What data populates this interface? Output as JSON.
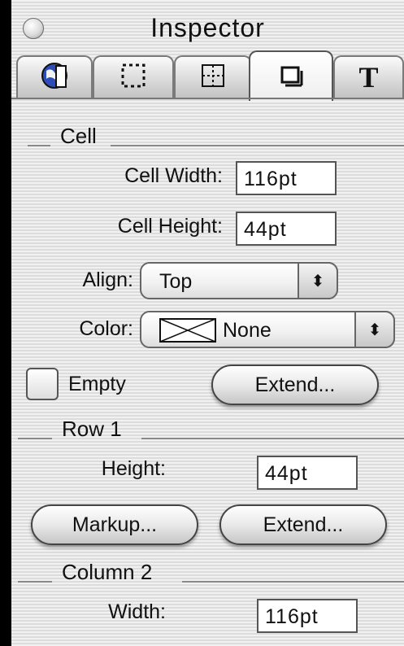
{
  "window": {
    "title": "Inspector",
    "tabs": [
      {
        "icon": "globe-icon",
        "active": false
      },
      {
        "icon": "dotted-square-icon",
        "active": false
      },
      {
        "icon": "grid-icon",
        "active": false
      },
      {
        "icon": "table-cell-icon",
        "active": true
      },
      {
        "icon": "text-icon",
        "glyph": "T",
        "active": false
      }
    ]
  },
  "cell": {
    "section_label": "Cell",
    "width_label": "Cell Width:",
    "width_value": "116pt",
    "height_label": "Cell Height:",
    "height_value": "44pt",
    "align_label": "Align:",
    "align_value": "Top",
    "color_label": "Color:",
    "color_value": "None",
    "empty_label": "Empty",
    "empty_checked": false,
    "extend_label": "Extend..."
  },
  "row": {
    "section_label": "Row 1",
    "height_label": "Height:",
    "height_value": "44pt",
    "markup_label": "Markup...",
    "extend_label": "Extend..."
  },
  "column": {
    "section_label": "Column 2",
    "width_label": "Width:",
    "width_value": "116pt"
  },
  "arrow_glyph": "⬍"
}
